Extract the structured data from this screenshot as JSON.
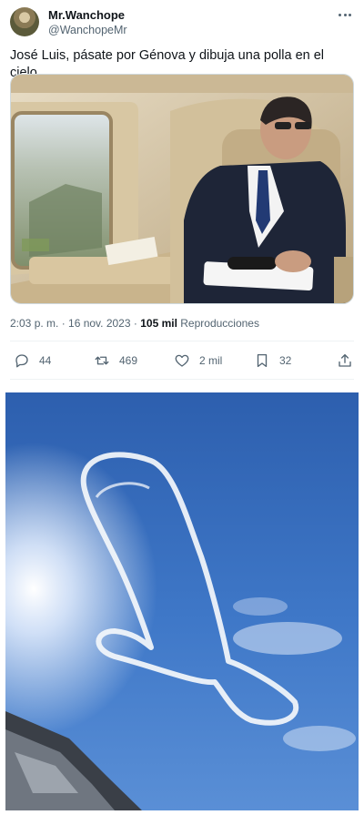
{
  "tweet": {
    "author": {
      "display_name": "Mr.Wanchope",
      "handle": "@WanchopeMr",
      "avatar_icon": "avatar-icon"
    },
    "text": "José Luis, pásate por Génova y dibuja una polla en el cielo.",
    "timestamp": "2:03 p. m. · 16 nov. 2023",
    "views_count": "105 mil",
    "views_label": "Reproducciones",
    "actions": {
      "replies": "44",
      "retweets": "469",
      "likes": "2 mil",
      "bookmarks": "32"
    },
    "icons": [
      "more-options-icon",
      "reply-icon",
      "retweet-icon",
      "like-icon",
      "bookmark-icon",
      "share-icon"
    ]
  },
  "colors": {
    "text_primary": "#0f1419",
    "text_secondary": "#536471",
    "divider": "#eff3f4",
    "sky_blue": "#3a6fc0"
  }
}
